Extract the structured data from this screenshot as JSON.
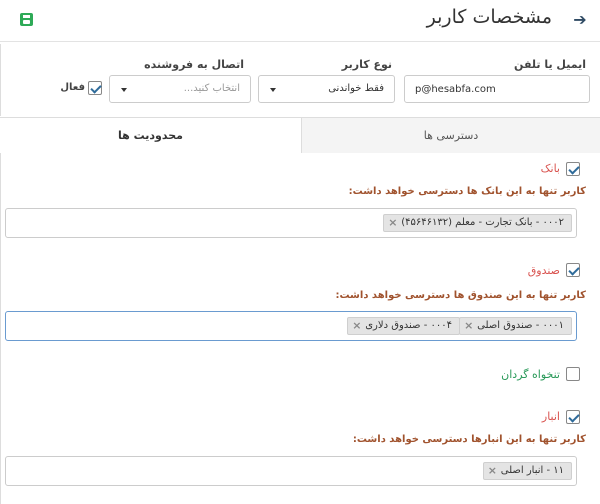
{
  "header": {
    "title": "مشخصات کاربر",
    "back_icon": "arrow-right-icon",
    "save_icon": "save-icon"
  },
  "form": {
    "email_label": "ایمیل یا تلفن",
    "email_value": "p@hesabfa.com",
    "user_type_label": "نوع کاربر",
    "user_type_value": "فقط خواندنی",
    "seller_link_label": "اتصال به فروشنده",
    "seller_link_placeholder": "انتخاب کنید...",
    "active_label": "فعال",
    "active_checked": true
  },
  "tabs": [
    {
      "label": "دسترسی ها",
      "active": false
    },
    {
      "label": "محدودیت ها",
      "active": true
    }
  ],
  "sections": {
    "bank": {
      "title": "بانک",
      "checked": true,
      "description": "کاربر تنها به این بانک ها دسترسی خواهد داشت:",
      "tags": [
        "۰۰۰۲ - بانک تجارت - معلم (۴۵۶۴۶۱۳۲)"
      ]
    },
    "fund": {
      "title": "صندوق",
      "checked": true,
      "description": "کاربر تنها به این صندوق ها دسترسی خواهد داشت:",
      "tags": [
        "۰۰۰۱ - صندوق اصلی",
        "۰۰۰۴ - صندوق دلاری"
      ]
    },
    "petty_cash": {
      "title": "تنخواه گردان",
      "checked": false
    },
    "warehouse": {
      "title": "انبار",
      "checked": true,
      "description": "کاربر تنها به این انبارها دسترسی خواهد داشت:",
      "tags": [
        "۱۱ - انبار اصلی"
      ]
    }
  },
  "colors": {
    "section_title": "#d9534f",
    "petty_cash_title": "#2a9a5a",
    "description": "#a0522d",
    "save_icon": "#2eaa57"
  }
}
